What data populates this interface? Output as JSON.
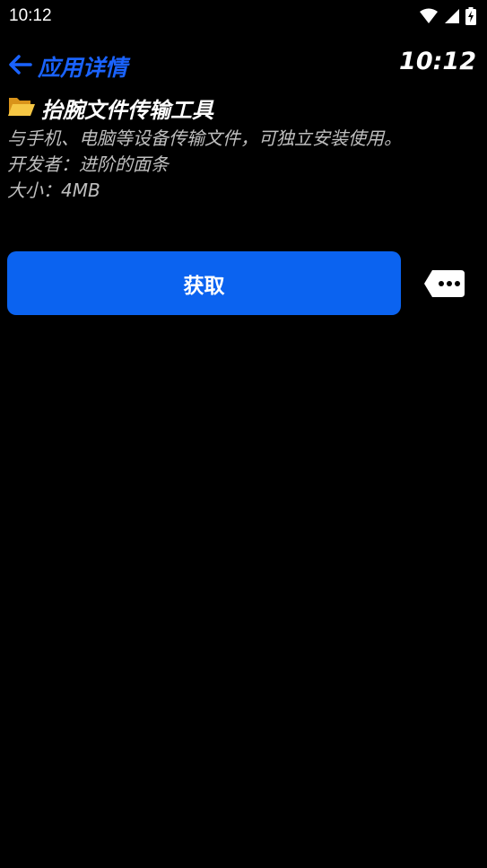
{
  "status_bar": {
    "time": "10:12",
    "icons": [
      "wifi-icon",
      "signal-icon",
      "battery-icon"
    ]
  },
  "header": {
    "back_label": "应用详情",
    "clock": "10:12"
  },
  "app": {
    "icon": "folder-icon",
    "name": "抬腕文件传输工具",
    "description": "与手机、电脑等设备传输文件，可独立安装使用。",
    "developer": "开发者：进阶的面条",
    "size": "大小：4MB"
  },
  "actions": {
    "get_label": "获取",
    "comment_icon": "comment-bubble-icon"
  },
  "colors": {
    "accent": "#0b63f0",
    "back_text": "#1a63ff",
    "secondary_text": "#bfbfbf",
    "background": "#000000"
  }
}
